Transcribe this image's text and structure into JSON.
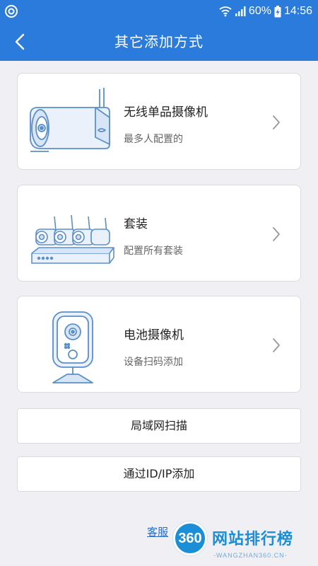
{
  "status_bar": {
    "battery": "60%",
    "time": "14:56"
  },
  "header": {
    "title": "其它添加方式"
  },
  "options": [
    {
      "title": "无线单品摄像机",
      "subtitle": "最多人配置的"
    },
    {
      "title": "套装",
      "subtitle": "配置所有套装"
    },
    {
      "title": "电池摄像机",
      "subtitle": "设备扫码添加"
    }
  ],
  "buttons": {
    "lan_scan": "局域网扫描",
    "id_ip_add": "通过ID/IP添加"
  },
  "footer": {
    "service": "客服",
    "watermark_badge": "360",
    "watermark_text": "网站排行榜",
    "watermark_url": "-WANGZHAN360.CN-"
  },
  "colors": {
    "header_bg": "#2b7bdc",
    "page_bg": "#efeff4",
    "illustration_stroke": "#5b8fc9",
    "link": "#2b6cc4"
  }
}
